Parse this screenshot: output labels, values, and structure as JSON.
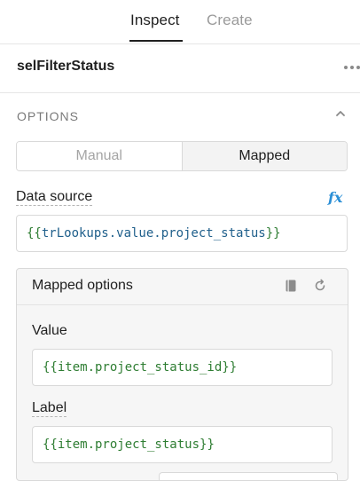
{
  "tabs": {
    "inspect": "Inspect",
    "create": "Create",
    "active": "inspect"
  },
  "component": {
    "name": "selFilterStatus",
    "more_icon": "ellipsis-icon"
  },
  "options": {
    "section_title": "OPTIONS",
    "collapse_icon": "chevron-up-icon",
    "mode": {
      "manual": "Manual",
      "mapped": "Mapped",
      "selected": "mapped"
    },
    "data_source": {
      "label": "Data source",
      "fx_label": "fx",
      "open_brace": "{{",
      "expression": "trLookups.value.project_status",
      "close_brace": "}}"
    },
    "mapped_options": {
      "title": "Mapped options",
      "doc_icon": "book-icon",
      "reset_icon": "reset-icon",
      "value": {
        "label": "Value",
        "open_brace": "{{ ",
        "expression": "item.project_status_id",
        "close_brace": " }}"
      },
      "label_field": {
        "label": "Label",
        "open_brace": "{{ ",
        "expression": "item.project_status",
        "close_brace": " }}"
      }
    }
  },
  "colors": {
    "accent_blue": "#2b8fd6",
    "code_green": "#2e7d32",
    "code_blue": "#1f5f8b",
    "muted_text": "#9a9a9a",
    "border": "#d9d9d9"
  }
}
